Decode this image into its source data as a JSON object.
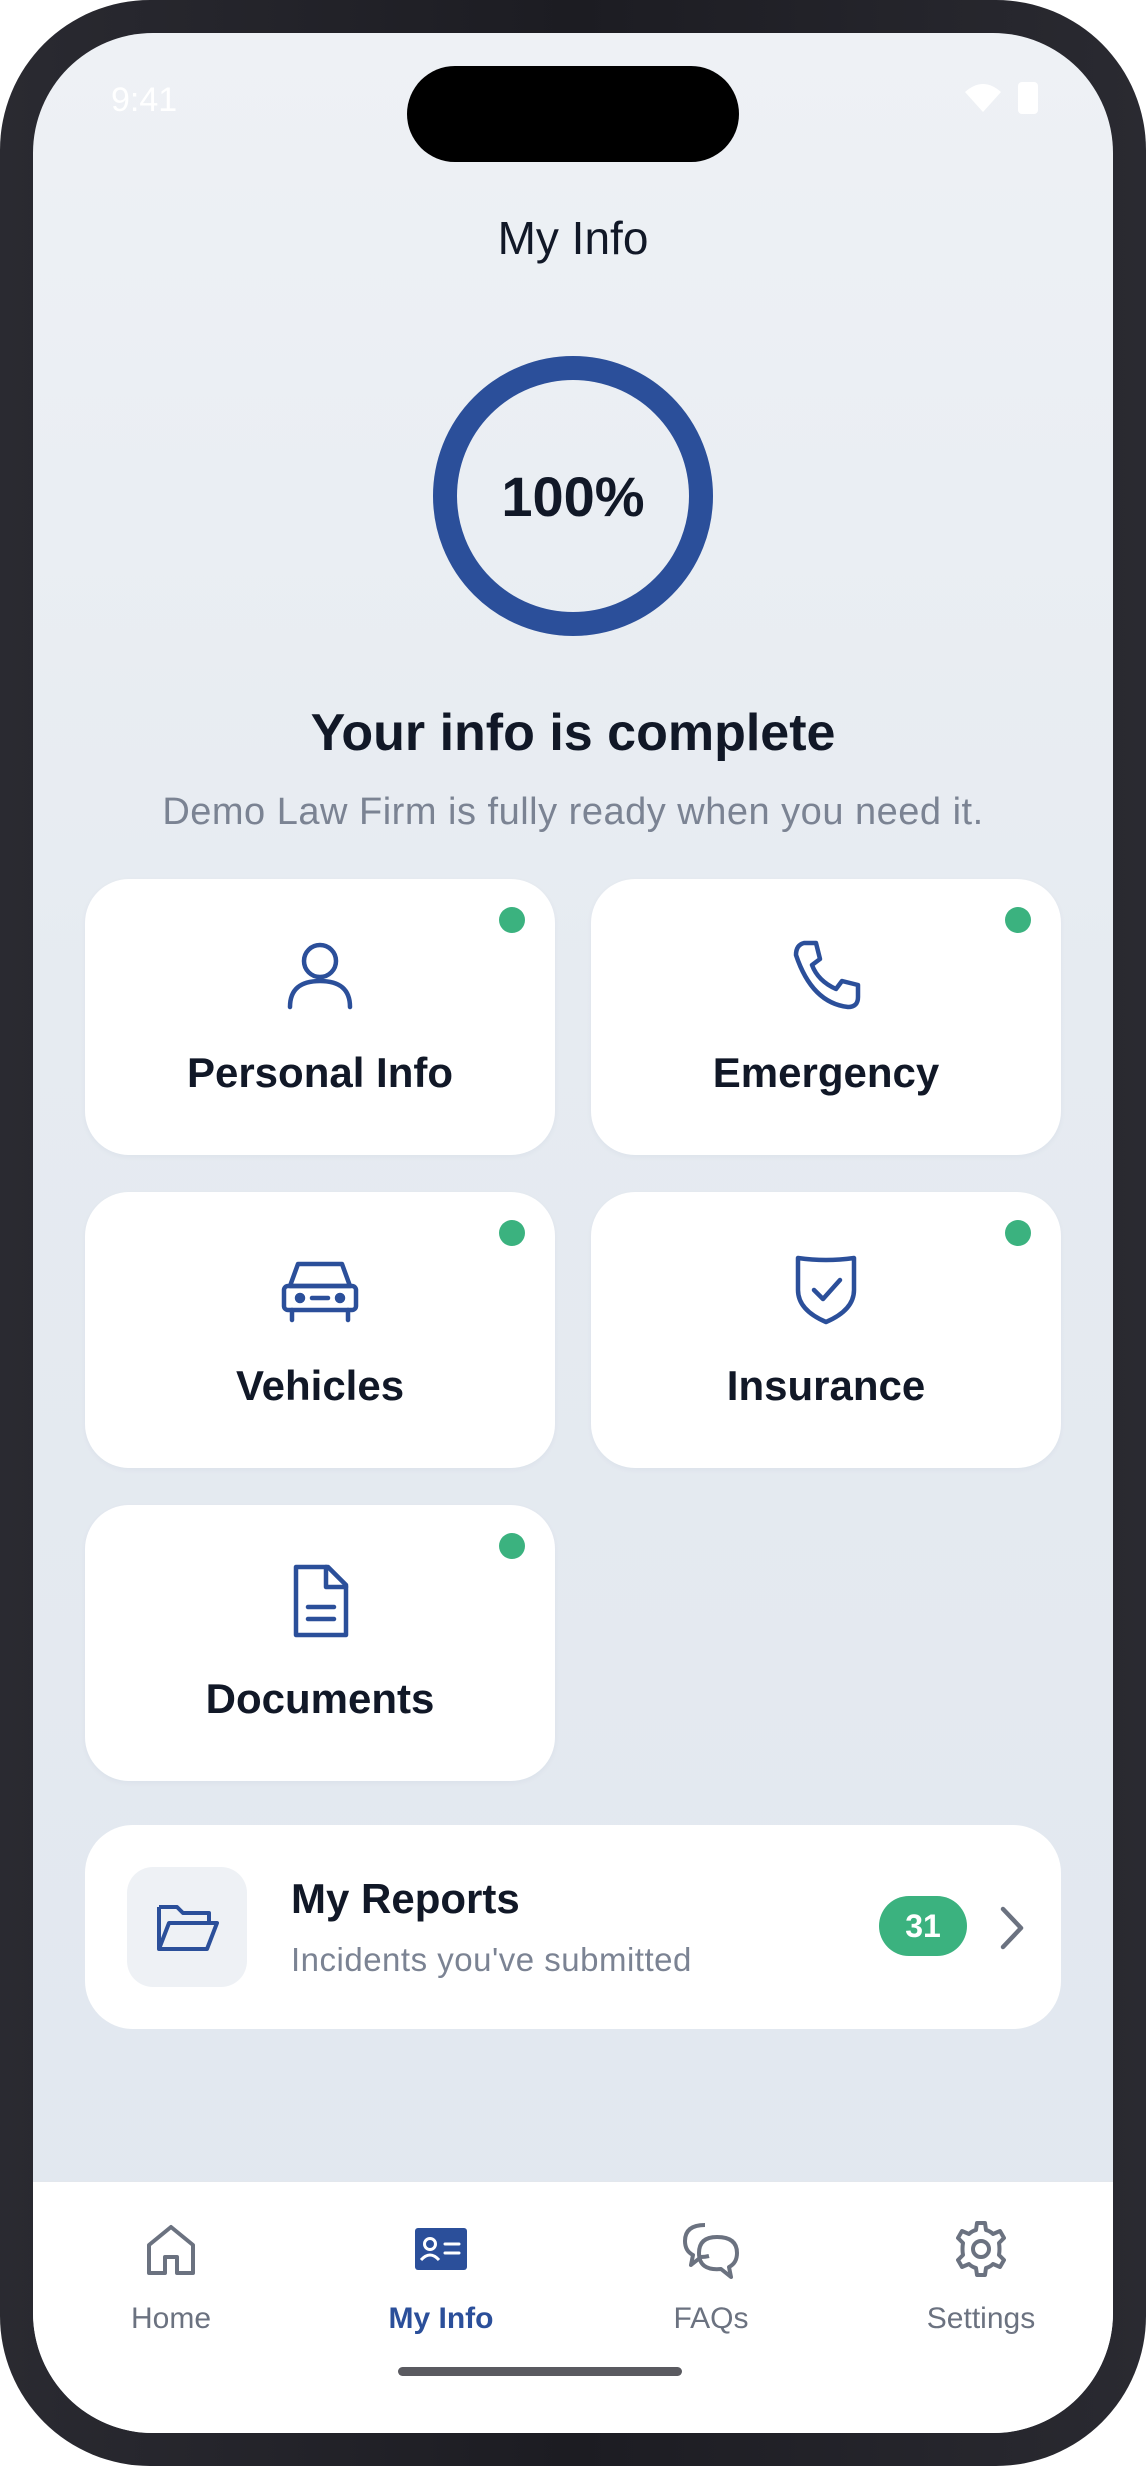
{
  "status_bar": {
    "time": "9:41"
  },
  "header": {
    "title": "My Info"
  },
  "progress": {
    "value": 1.0,
    "label": "100%"
  },
  "summary": {
    "headline": "Your info is complete",
    "subline": "Demo Law Firm is fully ready when you need it."
  },
  "sections": [
    {
      "label": "Personal Info",
      "icon": "person-icon",
      "complete": true
    },
    {
      "label": "Emergency",
      "icon": "phone-icon",
      "complete": true
    },
    {
      "label": "Vehicles",
      "icon": "car-icon",
      "complete": true
    },
    {
      "label": "Insurance",
      "icon": "shield-check-icon",
      "complete": true
    },
    {
      "label": "Documents",
      "icon": "document-icon",
      "complete": true
    }
  ],
  "reports": {
    "title": "My Reports",
    "subtitle": "Incidents you've submitted",
    "count": "31",
    "icon": "folder-open-icon"
  },
  "tabs": [
    {
      "label": "Home",
      "icon": "home-icon",
      "active": false
    },
    {
      "label": "My Info",
      "icon": "id-card-icon",
      "active": true
    },
    {
      "label": "FAQs",
      "icon": "chat-bubbles-icon",
      "active": false
    },
    {
      "label": "Settings",
      "icon": "gear-icon",
      "active": false
    }
  ],
  "colors": {
    "accent": "#2b4f9a",
    "complete_dot": "#3bb27f",
    "text_primary": "#111827",
    "text_secondary": "#7b8393",
    "background": "#e6ebf1"
  }
}
